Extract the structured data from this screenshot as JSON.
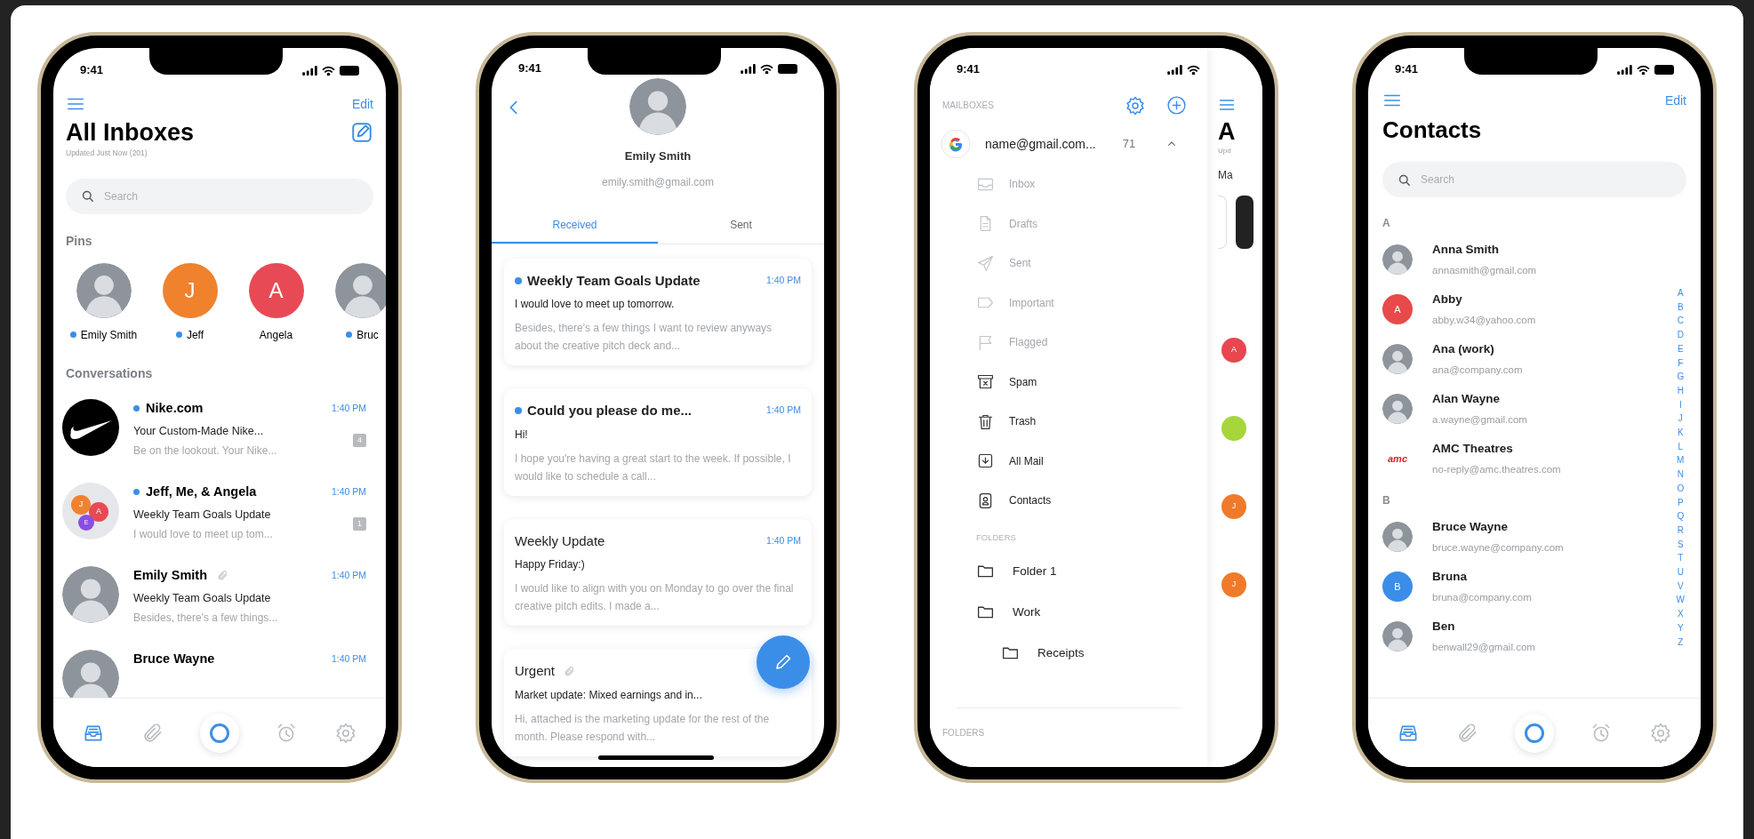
{
  "phones": [
    {
      "kind": "inbox",
      "time": "9:41",
      "edit": "Edit",
      "title": "All Inboxes",
      "subtitle": "Updated Just Now (201)",
      "search": {
        "placeholder": "Search"
      },
      "pins_heading": "Pins",
      "pins": [
        {
          "name": "Emily Smith",
          "unread": true,
          "avatar": {
            "kind": "photo"
          }
        },
        {
          "name": "Jeff",
          "unread": true,
          "avatar": {
            "kind": "initial",
            "initial": "J",
            "color": "#f0822e"
          }
        },
        {
          "name": "Angela",
          "unread": false,
          "avatar": {
            "kind": "initial",
            "initial": "A",
            "color": "#e84a55"
          }
        },
        {
          "name": "Bruc",
          "unread": true,
          "avatar": {
            "kind": "photo"
          }
        }
      ],
      "conversations_heading": "Conversations",
      "conversations": [
        {
          "sender": "Nike.com",
          "unread": true,
          "attachment": false,
          "time": "1:40 PM",
          "subject": "Your Custom-Made Nike...",
          "preview": "Be on the lookout. Your Nike...",
          "count": "4",
          "avatar": {
            "kind": "swoosh"
          }
        },
        {
          "sender": "Jeff, Me, & Angela",
          "unread": true,
          "attachment": false,
          "time": "1:40 PM",
          "subject": "Weekly Team Goals Update",
          "preview": "I would love to meet up tom...",
          "count": "1",
          "avatar": {
            "kind": "group",
            "members": [
              {
                "initial": "J",
                "color": "#f0822e"
              },
              {
                "initial": "A",
                "color": "#e84a55"
              },
              {
                "initial": "E",
                "color": "#8a4fe0"
              }
            ]
          }
        },
        {
          "sender": "Emily Smith",
          "unread": false,
          "attachment": true,
          "time": "1:40 PM",
          "subject": "Weekly Team Goals Update",
          "preview": "Besides, there's a few things...",
          "avatar": {
            "kind": "photo"
          }
        },
        {
          "sender": "Bruce Wayne",
          "unread": false,
          "attachment": false,
          "time": "1:40 PM",
          "avatar": {
            "kind": "photo"
          }
        }
      ],
      "tab_bar": [
        {
          "kind": "inbox",
          "selected": true
        },
        {
          "kind": "attachments",
          "selected": false
        },
        {
          "kind": "center",
          "selected": false
        },
        {
          "kind": "reminders",
          "selected": false
        },
        {
          "kind": "settings",
          "selected": false
        }
      ]
    },
    {
      "kind": "contact_detail",
      "time": "9:41",
      "name": "Emily Smith",
      "email": "emily.smith@gmail.com",
      "tabs": [
        {
          "label": "Received",
          "selected": true
        },
        {
          "label": "Sent",
          "selected": false
        }
      ],
      "messages": [
        {
          "subject": "Weekly Team Goals Update",
          "unread": true,
          "attachment": false,
          "time": "1:40 PM",
          "line": "I would love to meet up tomorrow.",
          "preview": "Besides, there's a few things I want to review anyways about the creative pitch deck and..."
        },
        {
          "subject": "Could you please do me...",
          "unread": true,
          "attachment": false,
          "time": "1:40 PM",
          "line": "Hi!",
          "preview": "I hope you're having a great start to the week. If possible, I would like to schedule a call..."
        },
        {
          "subject": "Weekly Update",
          "unread": false,
          "attachment": false,
          "time": "1:40 PM",
          "line": "Happy Friday:)",
          "preview": "I would like to align with you on Monday to go over the final creative pitch edits. I made a..."
        },
        {
          "subject": "Urgent",
          "unread": false,
          "attachment": true,
          "line": "Market update: Mixed earnings and in...",
          "preview": "Hi, attached is the marketing update for the rest of the month. Please respond with..."
        }
      ]
    },
    {
      "kind": "mailboxes",
      "time": "9:41",
      "heading": "MAILBOXES",
      "account": {
        "address": "name@gmail.com...",
        "count": "71",
        "expanded": true
      },
      "mailboxes": [
        {
          "label": "Inbox",
          "kind": "inbox",
          "disabled": true
        },
        {
          "label": "Drafts",
          "kind": "drafts",
          "disabled": true
        },
        {
          "label": "Sent",
          "kind": "sent",
          "disabled": true
        },
        {
          "label": "Important",
          "kind": "important",
          "disabled": true
        },
        {
          "label": "Flagged",
          "kind": "flagged",
          "disabled": true
        },
        {
          "label": "Spam",
          "kind": "spam",
          "disabled": false
        },
        {
          "label": "Trash",
          "kind": "trash",
          "disabled": false
        },
        {
          "label": "All Mail",
          "kind": "all_mail",
          "disabled": false
        },
        {
          "label": "Contacts",
          "kind": "contacts",
          "disabled": false
        }
      ],
      "folders_heading": "FOLDERS",
      "folders": [
        {
          "label": "Folder 1"
        },
        {
          "label": "Work",
          "children": [
            {
              "label": "Receipts"
            }
          ]
        }
      ],
      "footer_heading": "FOLDERS",
      "peek": {
        "title": "A",
        "subtitle": "Upd",
        "label": "Ma",
        "avatars": [
          {
            "initial": "A",
            "color": "#e8474f"
          },
          {
            "color": "#a6d63c"
          },
          {
            "initial": "J",
            "color": "#f07a2a"
          },
          {
            "initial": "J",
            "color": "#f07a2a"
          }
        ]
      }
    },
    {
      "kind": "contacts",
      "time": "9:41",
      "edit": "Edit",
      "title": "Contacts",
      "search": {
        "placeholder": "Search"
      },
      "sections": [
        {
          "letter": "A",
          "contacts": [
            {
              "name": "Anna Smith",
              "email": "annasmith@gmail.com",
              "avatar": {
                "kind": "photo"
              }
            },
            {
              "name": "Abby",
              "email": "abby.w34@yahoo.com",
              "avatar": {
                "kind": "initial",
                "initial": "A",
                "color": "#e84a4a"
              }
            },
            {
              "name": "Ana (work)",
              "email": "ana@company.com",
              "avatar": {
                "kind": "photo"
              }
            },
            {
              "name": "Alan Wayne",
              "email": "a.wayne@gmail.com",
              "avatar": {
                "kind": "photo"
              }
            },
            {
              "name": "AMC Theatres",
              "email": "no-reply@amc.theatres.com",
              "avatar": {
                "kind": "wordmark",
                "text": "amc"
              }
            }
          ]
        },
        {
          "letter": "B",
          "contacts": [
            {
              "name": "Bruce Wayne",
              "email": "bruce.wayne@company.com",
              "avatar": {
                "kind": "photo"
              }
            },
            {
              "name": "Bruna",
              "email": "bruna@company.com",
              "avatar": {
                "kind": "initial",
                "initial": "B",
                "color": "#3b8de8"
              }
            },
            {
              "name": "Ben",
              "email": "benwall29@gmail.com",
              "avatar": {
                "kind": "photo"
              }
            }
          ]
        }
      ],
      "index": [
        "A",
        "B",
        "C",
        "D",
        "E",
        "F",
        "G",
        "H",
        "I",
        "J",
        "K",
        "L",
        "M",
        "N",
        "O",
        "P",
        "Q",
        "R",
        "S",
        "T",
        "U",
        "V",
        "W",
        "X",
        "Y",
        "Z"
      ],
      "tab_bar": [
        {
          "kind": "inbox",
          "selected": true
        },
        {
          "kind": "attachments",
          "selected": false
        },
        {
          "kind": "center",
          "selected": false
        },
        {
          "kind": "reminders",
          "selected": false
        },
        {
          "kind": "settings",
          "selected": false
        }
      ]
    }
  ]
}
